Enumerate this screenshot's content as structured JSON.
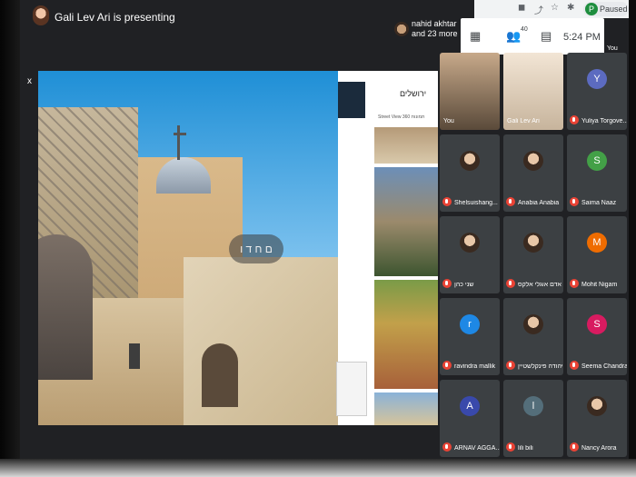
{
  "presenter": {
    "text": "Gali Lev Ari is presenting"
  },
  "participants_summary": {
    "line1": "nahid akhtar",
    "line2": "and 23 more"
  },
  "browser": {
    "paused_label": "Paused",
    "profile_letter": "P"
  },
  "meet": {
    "people_count": "40",
    "time": "5:24 PM",
    "you_label": "You"
  },
  "presentation": {
    "overlay_text": "ם ח ד ו",
    "panel_title": "ירושלים",
    "panel_sub": "Street View  360 תמונות",
    "close_glyph": "x"
  },
  "tiles": [
    {
      "name": "You",
      "video": true,
      "letter": "",
      "color": ""
    },
    {
      "name": "Gali Lev Ari",
      "video": true,
      "letter": "",
      "color": ""
    },
    {
      "name": "Yuliya Torgove...",
      "video": false,
      "letter": "Y",
      "color": "#5c6bc0"
    },
    {
      "name": "Shelsuishang...",
      "video": false,
      "letter": "",
      "color": "",
      "photo": true
    },
    {
      "name": "Anabia Anabia",
      "video": false,
      "letter": "",
      "color": "",
      "photo": true
    },
    {
      "name": "Saima Naaz",
      "video": false,
      "letter": "S",
      "color": "#43a047"
    },
    {
      "name": "שני כהן",
      "video": false,
      "letter": "",
      "color": "",
      "photo": true
    },
    {
      "name": "אדם אוגלי אלקס",
      "video": false,
      "letter": "",
      "color": "",
      "photo": true
    },
    {
      "name": "Mohit Nigam",
      "video": false,
      "letter": "M",
      "color": "#ef6c00"
    },
    {
      "name": "ravindra mallik",
      "video": false,
      "letter": "r",
      "color": "#1e88e5"
    },
    {
      "name": "יהודה פינקלשטיין",
      "video": false,
      "letter": "",
      "color": "",
      "photo": true
    },
    {
      "name": "Seema Chandra",
      "video": false,
      "letter": "S",
      "color": "#d81b60"
    },
    {
      "name": "ARNAV AGGA...",
      "video": false,
      "letter": "A",
      "color": "#3949ab"
    },
    {
      "name": "lili bili",
      "video": false,
      "letter": "l",
      "color": "#546e7a"
    },
    {
      "name": "Nancy Arora",
      "video": false,
      "letter": "",
      "color": "",
      "photo": true
    }
  ]
}
